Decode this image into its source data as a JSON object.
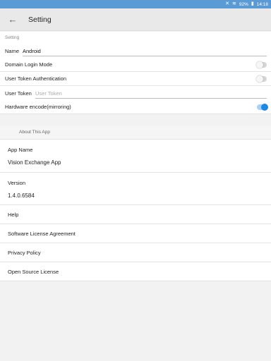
{
  "status_bar": {
    "icons": [
      "mute-icon",
      "wifi-icon",
      "battery-icon"
    ],
    "battery": "92%",
    "time": "14:18",
    "background": "#5b9bd5"
  },
  "app_bar": {
    "title": "Setting"
  },
  "settings": {
    "section_label": "Setting",
    "name_label": "Name",
    "name_value": "Android",
    "domain_login_label": "Domain Login Mode",
    "domain_login_on": false,
    "user_token_auth_label": "User Token Authentication",
    "user_token_auth_on": false,
    "user_token_label": "User Token",
    "user_token_placeholder": "User Token",
    "hw_encode_label": "Hardware encode(mirroring)",
    "hw_encode_on": true
  },
  "about": {
    "section_label": "About This App",
    "app_name_label": "App Name",
    "app_name_value": "Vision Exchange App",
    "version_label": "Version",
    "version_value": "1.4.0.6584",
    "links": [
      "Help",
      "Software License Agreement",
      "Privacy Policy",
      "Open Source License"
    ]
  },
  "colors": {
    "accent": "#1e88e5"
  }
}
